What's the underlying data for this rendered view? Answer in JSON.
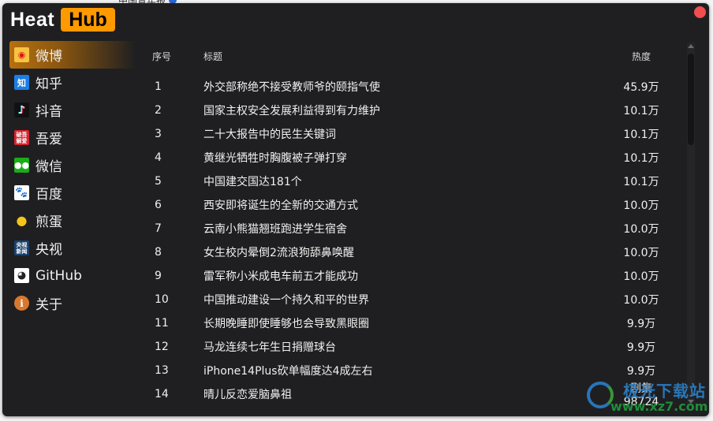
{
  "app": {
    "logo_part1": "Heat",
    "logo_part2": "Hub",
    "accent_color": "#ff9900",
    "close_color": "#f24e4e"
  },
  "background": {
    "partial_text": "中国青年报"
  },
  "sidebar": {
    "items": [
      {
        "label": "微博",
        "icon": "weibo-icon",
        "glyph": "◉",
        "active": true
      },
      {
        "label": "知乎",
        "icon": "zhihu-icon",
        "glyph": "知",
        "active": false
      },
      {
        "label": "抖音",
        "icon": "douyin-icon",
        "glyph": "♪",
        "active": false
      },
      {
        "label": "吾爱",
        "icon": "52pojie-icon",
        "glyph": "破吾 解爱",
        "active": false
      },
      {
        "label": "微信",
        "icon": "wechat-icon",
        "glyph": "●●",
        "active": false
      },
      {
        "label": "百度",
        "icon": "baidu-icon",
        "glyph": "🐾",
        "active": false
      },
      {
        "label": "煎蛋",
        "icon": "jiandan-icon",
        "glyph": "●",
        "active": false
      },
      {
        "label": "央视",
        "icon": "cctv-icon",
        "glyph": "央视 新闻",
        "active": false
      },
      {
        "label": "GitHub",
        "icon": "github-icon",
        "glyph": "◕",
        "active": false
      },
      {
        "label": "关于",
        "icon": "about-icon",
        "glyph": "i",
        "active": false
      }
    ]
  },
  "table": {
    "headers": {
      "index": "序号",
      "title": "标题",
      "heat": "热度"
    },
    "rows": [
      {
        "index": "1",
        "title": "外交部称绝不接受教师爷的颐指气使",
        "heat": "45.9万"
      },
      {
        "index": "2",
        "title": "国家主权安全发展利益得到有力维护",
        "heat": "10.1万"
      },
      {
        "index": "3",
        "title": "二十大报告中的民生关键词",
        "heat": "10.1万"
      },
      {
        "index": "4",
        "title": "黄继光牺牲时胸腹被子弹打穿",
        "heat": "10.1万"
      },
      {
        "index": "5",
        "title": "中国建交国达181个",
        "heat": "10.1万"
      },
      {
        "index": "6",
        "title": "西安即将诞生的全新的交通方式",
        "heat": "10.0万"
      },
      {
        "index": "7",
        "title": "云南小熊猫翘班跑进学生宿舍",
        "heat": "10.0万"
      },
      {
        "index": "8",
        "title": "女生校内晕倒2流浪狗舔鼻唤醒",
        "heat": "10.0万"
      },
      {
        "index": "9",
        "title": "雷军称小米成电车前五才能成功",
        "heat": "10.0万"
      },
      {
        "index": "10",
        "title": "中国推动建设一个持久和平的世界",
        "heat": "10.0万"
      },
      {
        "index": "11",
        "title": "长期晚睡即使睡够也会导致黑眼圈",
        "heat": "9.9万"
      },
      {
        "index": "12",
        "title": "马龙连续七年生日捐赠球台",
        "heat": "9.9万"
      },
      {
        "index": "13",
        "title": "iPhone14Plus砍单幅度达4成左右",
        "heat": "9.9万"
      },
      {
        "index": "14",
        "title": "晴儿反恋爱脑鼻祖",
        "heat": "剧集98724"
      }
    ]
  },
  "watermark": {
    "cn": "极光下载站",
    "url": "www.xz7.com"
  }
}
